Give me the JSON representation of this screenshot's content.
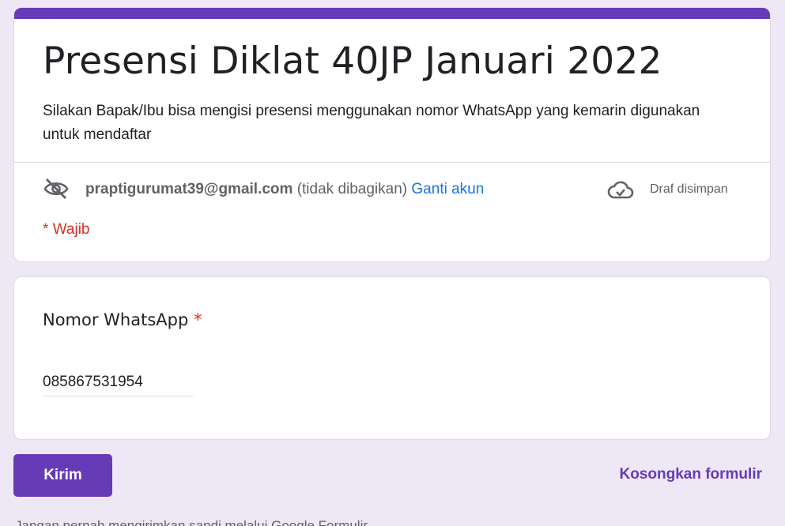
{
  "form": {
    "title": "Presensi Diklat 40JP Januari 2022",
    "description": "Silakan Bapak/Ibu bisa mengisi presensi menggunakan nomor WhatsApp yang kemarin digunakan untuk mendaftar",
    "accent_color": "#673ab7"
  },
  "account": {
    "email": "praptigurumat39@gmail.com",
    "not_shared": "(tidak dibagikan)",
    "switch_label": "Ganti akun",
    "draft_status": "Draf disimpan",
    "hidden_icon": "eye-off-icon",
    "cloud_icon": "cloud-check-icon"
  },
  "required_note": "* Wajib",
  "question": {
    "label": "Nomor WhatsApp",
    "required_mark": "*",
    "value": "085867531954"
  },
  "actions": {
    "submit_label": "Kirim",
    "clear_label": "Kosongkan formulir"
  },
  "footer": {
    "warning": "Jangan pernah mengirimkan sandi melalui Google Formulir."
  }
}
